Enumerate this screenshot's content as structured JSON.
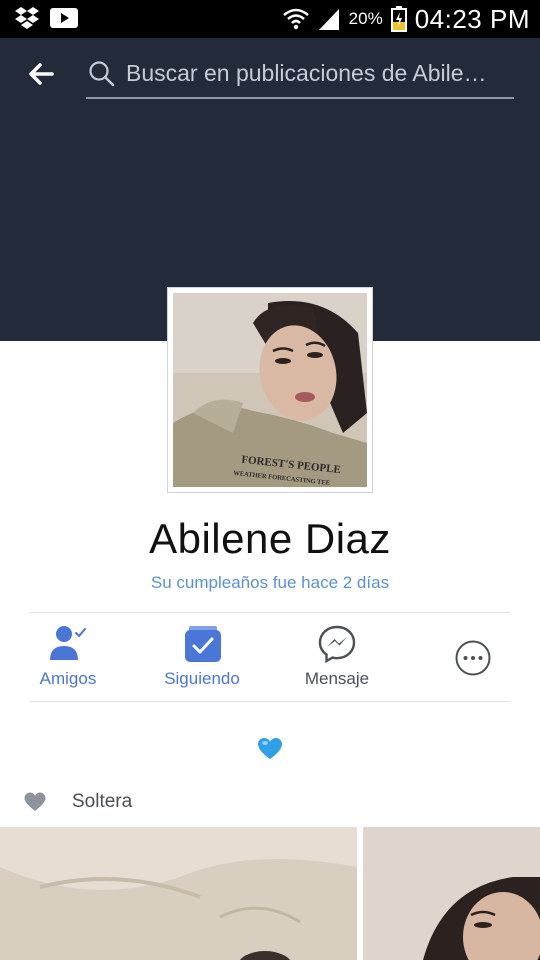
{
  "status_bar": {
    "battery_percent": "20%",
    "time": "04:23 PM",
    "icons": [
      "dropbox-icon",
      "youtube-icon",
      "wifi-icon",
      "signal-icon",
      "battery-icon"
    ]
  },
  "header": {
    "search_placeholder": "Buscar en publicaciones de Abile…"
  },
  "profile": {
    "name": "Abilene Diaz",
    "birthday_note": "Su cumpleaños fue hace 2 días",
    "photo_shirt_text_1": "FOREST'S PEOPLE",
    "photo_shirt_text_2": "WEATHER FORECASTING TEE"
  },
  "actions": [
    {
      "label": "Amigos",
      "icon": "friends-check-icon"
    },
    {
      "label": "Siguiendo",
      "icon": "following-check-icon"
    },
    {
      "label": "Mensaje",
      "icon": "messenger-icon"
    },
    {
      "label": "",
      "icon": "more-options-icon"
    }
  ],
  "bio_emoji": "blue-heart-icon",
  "relationship": {
    "icon": "heart-icon",
    "text": "Soltera"
  },
  "colors": {
    "header_bg": "#232a3a",
    "accent_blue": "#4a76d8",
    "link_blue": "#5b8fd6",
    "gray_text": "#4b4f56"
  }
}
